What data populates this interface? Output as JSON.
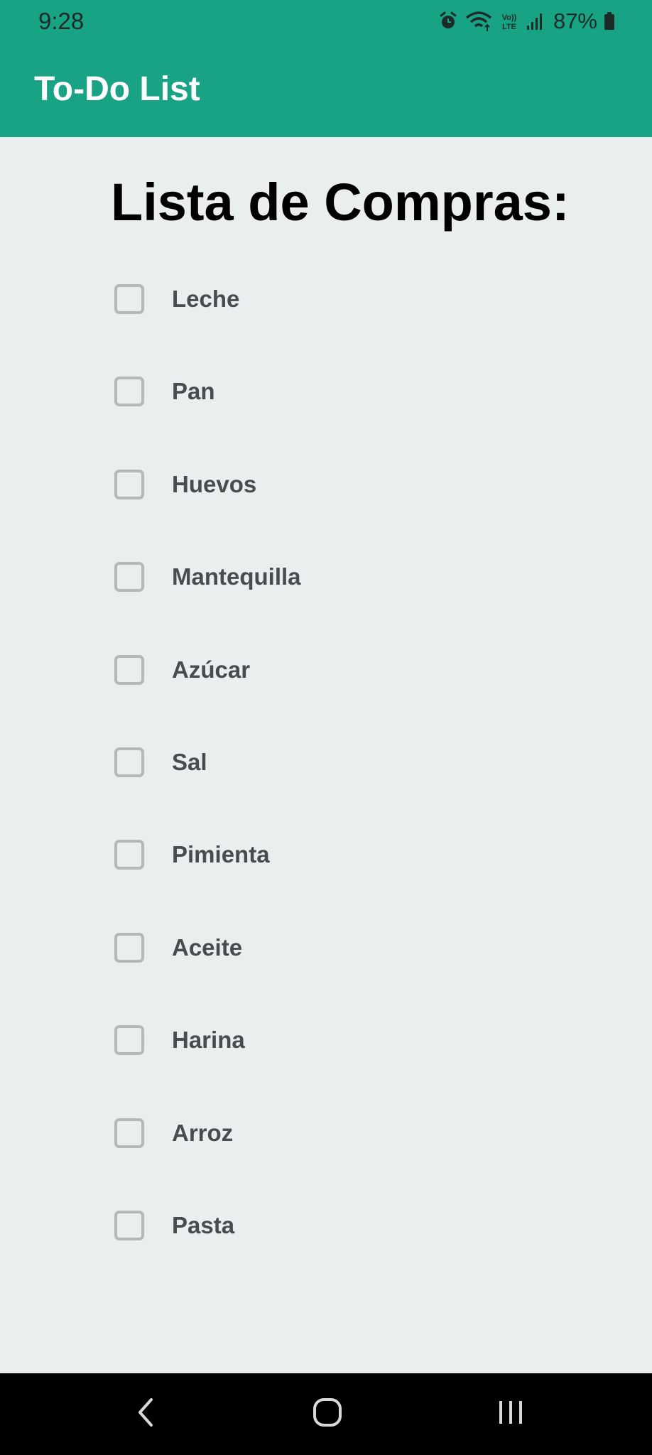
{
  "status_bar": {
    "time": "9:28",
    "battery": "87%",
    "icons": [
      "alarm-icon",
      "wifi-icon",
      "volte-icon",
      "signal-icon",
      "battery-icon"
    ],
    "volte_top": "Vo))",
    "volte_bottom": "LTE"
  },
  "app_bar": {
    "title": "To-Do List"
  },
  "main": {
    "list_title": "Lista de Compras:",
    "items": [
      {
        "label": "Leche",
        "checked": false
      },
      {
        "label": "Pan",
        "checked": false
      },
      {
        "label": "Huevos",
        "checked": false
      },
      {
        "label": "Mantequilla",
        "checked": false
      },
      {
        "label": "Azúcar",
        "checked": false
      },
      {
        "label": "Sal",
        "checked": false
      },
      {
        "label": "Pimienta",
        "checked": false
      },
      {
        "label": "Aceite",
        "checked": false
      },
      {
        "label": "Harina",
        "checked": false
      },
      {
        "label": "Arroz",
        "checked": false
      },
      {
        "label": "Pasta",
        "checked": false
      }
    ]
  },
  "nav_bar": {
    "buttons": [
      "back-icon",
      "home-icon",
      "recents-icon"
    ]
  },
  "colors": {
    "accent": "#19a385",
    "background": "#eaeeee",
    "nav_background": "#000000",
    "item_text": "#494b50",
    "checkbox_border": "#b5b8b8"
  }
}
